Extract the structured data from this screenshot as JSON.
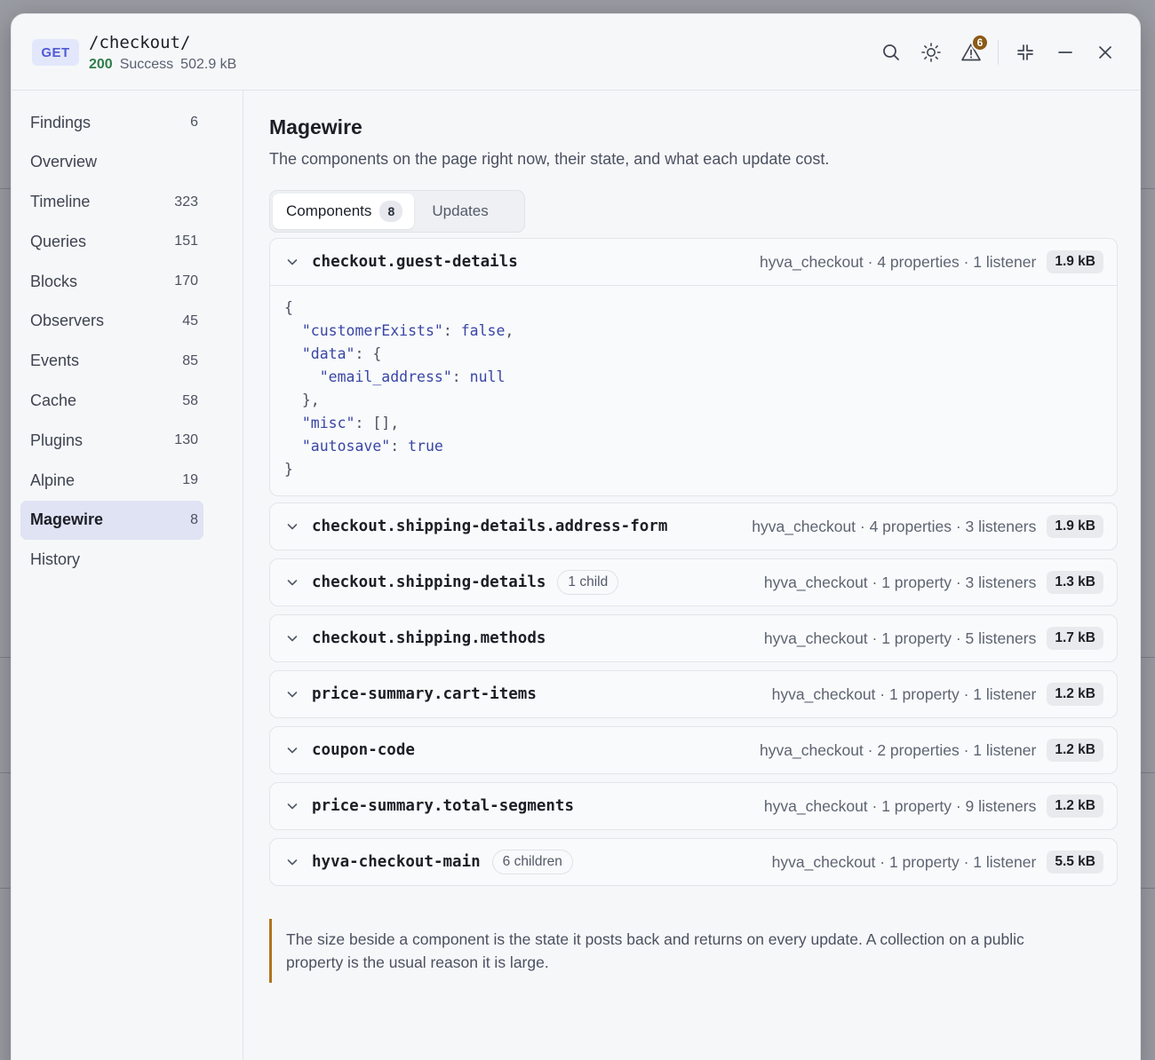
{
  "request": {
    "method": "GET",
    "path": "/checkout/",
    "status_code": "200",
    "status_text": "Success",
    "size": "502.9 kB"
  },
  "header_icons": {
    "search": "search-icon",
    "theme": "sun-icon",
    "warnings": "warning-icon",
    "warnings_count": "6",
    "collapse": "minimize-arrows-icon",
    "minimize": "minimize-icon",
    "close": "close-icon"
  },
  "sidebar": {
    "items": [
      {
        "label": "Findings",
        "count": "6"
      },
      {
        "label": "Overview",
        "count": ""
      },
      {
        "label": "Timeline",
        "count": "323"
      },
      {
        "label": "Queries",
        "count": "151"
      },
      {
        "label": "Blocks",
        "count": "170"
      },
      {
        "label": "Observers",
        "count": "45"
      },
      {
        "label": "Events",
        "count": "85"
      },
      {
        "label": "Cache",
        "count": "58"
      },
      {
        "label": "Plugins",
        "count": "130"
      },
      {
        "label": "Alpine",
        "count": "19"
      },
      {
        "label": "Magewire",
        "count": "8"
      },
      {
        "label": "History",
        "count": ""
      }
    ],
    "active": "Magewire"
  },
  "main": {
    "title": "Magewire",
    "subtitle": "The components on the page right now, their state, and what each update cost.",
    "tabs": [
      {
        "label": "Components",
        "count": "8"
      },
      {
        "label": "Updates"
      }
    ],
    "components": [
      {
        "name": "checkout.guest-details",
        "children": "",
        "meta": "hyva_checkout · 4 properties · 1 listener",
        "size": "1.9 kB",
        "expanded": true
      },
      {
        "name": "checkout.shipping-details.address-form",
        "children": "",
        "meta": "hyva_checkout · 4 properties · 3 listeners",
        "size": "1.9 kB"
      },
      {
        "name": "checkout.shipping-details",
        "children": "1 child",
        "meta": "hyva_checkout · 1 property · 3 listeners",
        "size": "1.3 kB"
      },
      {
        "name": "checkout.shipping.methods",
        "children": "",
        "meta": "hyva_checkout · 1 property · 5 listeners",
        "size": "1.7 kB"
      },
      {
        "name": "price-summary.cart-items",
        "children": "",
        "meta": "hyva_checkout · 1 property · 1 listener",
        "size": "1.2 kB"
      },
      {
        "name": "coupon-code",
        "children": "",
        "meta": "hyva_checkout · 2 properties · 1 listener",
        "size": "1.2 kB"
      },
      {
        "name": "price-summary.total-segments",
        "children": "",
        "meta": "hyva_checkout · 1 property · 9 listeners",
        "size": "1.2 kB"
      },
      {
        "name": "hyva-checkout-main",
        "children": "6 children",
        "meta": "hyva_checkout · 1 property · 1 listener",
        "size": "5.5 kB"
      }
    ],
    "state_json": {
      "open": "{",
      "line1_key": "\"customerExists\"",
      "line1_val": "false",
      "line2_key": "\"data\"",
      "line3_key": "\"email_address\"",
      "line3_val": "null",
      "line4": "},",
      "line5_key": "\"misc\"",
      "line5_val": "[]",
      "line6_key": "\"autosave\"",
      "line6_val": "true",
      "close": "}"
    },
    "note": "The size beside a component is the state it posts back and returns on every update. A collection on a public property is the usual reason it is large."
  }
}
